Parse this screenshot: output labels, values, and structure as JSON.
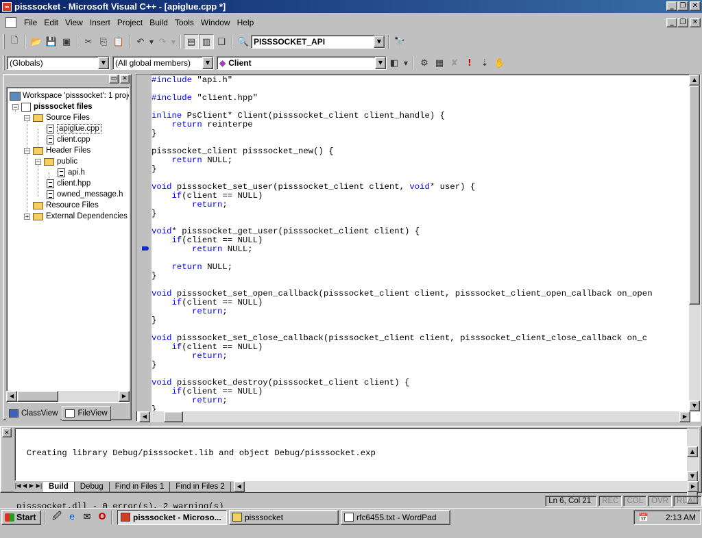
{
  "window": {
    "title": "pisssocket - Microsoft Visual C++ - [apiglue.cpp *]"
  },
  "menu": {
    "items": [
      "File",
      "Edit",
      "View",
      "Insert",
      "Project",
      "Build",
      "Tools",
      "Window",
      "Help"
    ]
  },
  "toolbar": {
    "config_combo": "PISSSOCKET_API"
  },
  "wizardbar": {
    "scope": "(Globals)",
    "filter": "(All global members)",
    "member": "Client"
  },
  "workspace": {
    "root": "Workspace 'pisssocket': 1 proje",
    "project": "pisssocket files",
    "source_folder": "Source Files",
    "source_files": [
      "apiglue.cpp",
      "client.cpp"
    ],
    "header_folder": "Header Files",
    "public_folder": "public",
    "public_files": [
      "api.h"
    ],
    "header_files": [
      "client.hpp",
      "owned_message.h"
    ],
    "resource_folder": "Resource Files",
    "external_folder": "External Dependencies",
    "tabs": [
      "ClassView",
      "FileView"
    ]
  },
  "editor": {
    "lines": [
      "#include \"api.h\"",
      "",
      "#include \"client.hpp\"",
      "",
      "inline PsClient* Client(pisssocket_client client_handle) {",
      "    return reinterpe",
      "}",
      "",
      "pisssocket_client pisssocket_new() {",
      "    return NULL;",
      "}",
      "",
      "void pisssocket_set_user(pisssocket_client client, void* user) {",
      "    if(client == NULL)",
      "        return;",
      "}",
      "",
      "void* pisssocket_get_user(pisssocket_client client) {",
      "    if(client == NULL)",
      "        return NULL;",
      "",
      "    return NULL;",
      "}",
      "",
      "void pisssocket_set_open_callback(pisssocket_client client, pisssocket_client_open_callback on_open",
      "    if(client == NULL)",
      "        return;",
      "}",
      "",
      "void pisssocket_set_close_callback(pisssocket_client client, pisssocket_client_close_callback on_c",
      "    if(client == NULL)",
      "        return;",
      "}",
      "",
      "void pisssocket_destroy(pisssocket_client client) {",
      "    if(client == NULL)",
      "        return;",
      "}"
    ]
  },
  "output": {
    "lines": [
      "  Creating library Debug/pisssocket.lib and object Debug/pisssocket.exp",
      "",
      "pisssocket.dll - 0 error(s), 2 warning(s)"
    ],
    "tabs": [
      "Build",
      "Debug",
      "Find in Files 1",
      "Find in Files 2"
    ]
  },
  "status": {
    "position": "Ln 6, Col 21",
    "indicators": [
      "REC",
      "COL",
      "OVR",
      "READ"
    ]
  },
  "taskbar": {
    "start": "Start",
    "tasks": [
      "pisssocket - Microso...",
      "pisssocket",
      "rfc6455.txt - WordPad"
    ],
    "clock": "2:13 AM"
  }
}
